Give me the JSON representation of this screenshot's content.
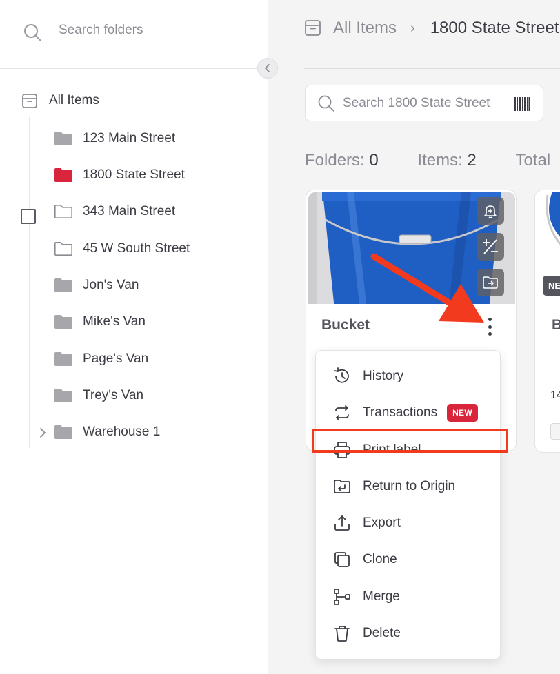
{
  "sidebar": {
    "search_placeholder": "Search folders",
    "root_label": "All Items",
    "folders": [
      {
        "name": "123 Main Street",
        "icon": "folder-filled-icon",
        "color": "#a7a7ab"
      },
      {
        "name": "1800 State Street",
        "icon": "folder-filled-icon",
        "color": "#d9253b",
        "active": true
      },
      {
        "name": "343 Main Street",
        "icon": "folder-outline-icon"
      },
      {
        "name": "45 W South Street",
        "icon": "folder-outline-icon"
      },
      {
        "name": "Jon's Van",
        "icon": "folder-filled-icon",
        "color": "#a7a7ab"
      },
      {
        "name": "Mike's Van",
        "icon": "folder-filled-icon",
        "color": "#a7a7ab"
      },
      {
        "name": "Page's Van",
        "icon": "folder-filled-icon",
        "color": "#a7a7ab"
      },
      {
        "name": "Trey's Van",
        "icon": "folder-filled-icon",
        "color": "#a7a7ab"
      },
      {
        "name": "Warehouse 1",
        "icon": "folder-filled-icon",
        "color": "#a7a7ab",
        "expandable": true
      }
    ]
  },
  "breadcrumb": {
    "root": "All Items",
    "separator": "›",
    "current": "1800 State Street"
  },
  "main_search": {
    "placeholder": "Search 1800 State Street"
  },
  "stats": {
    "folders_label": "Folders:",
    "folders_value": "0",
    "items_label": "Items:",
    "items_value": "2",
    "total_label": "Total"
  },
  "card": {
    "title": "Bucket",
    "image_subject": "blue-bucket"
  },
  "card2": {
    "badge": "NE",
    "title_fragment": "B",
    "value_fragment": "14"
  },
  "menu": {
    "items": [
      {
        "label": "History",
        "icon": "history-icon"
      },
      {
        "label": "Transactions",
        "icon": "transactions-icon",
        "badge": "NEW"
      },
      {
        "label": "Print label",
        "icon": "printer-icon",
        "highlighted": true
      },
      {
        "label": "Return to Origin",
        "icon": "return-origin-icon"
      },
      {
        "label": "Export",
        "icon": "export-icon"
      },
      {
        "label": "Clone",
        "icon": "clone-icon"
      },
      {
        "label": "Merge",
        "icon": "merge-icon"
      },
      {
        "label": "Delete",
        "icon": "trash-icon"
      }
    ]
  },
  "colors": {
    "accent_red": "#d9253b",
    "annotation_red": "#f23a1e",
    "bucket_blue": "#1f5fc4"
  }
}
